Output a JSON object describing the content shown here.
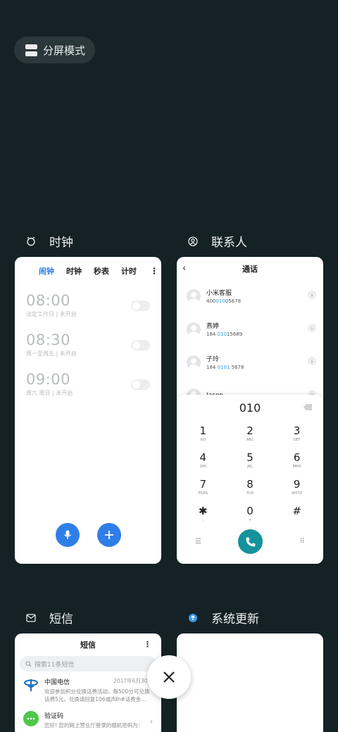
{
  "split_screen": {
    "label": "分屏模式"
  },
  "clock": {
    "title": "时钟",
    "tabs": [
      "闹钟",
      "时钟",
      "秒表",
      "计时"
    ],
    "alarms": [
      {
        "time": "08:00",
        "desc": "法定工作日 | 未开启"
      },
      {
        "time": "08:30",
        "desc": "周一至周五 | 未开启"
      },
      {
        "time": "09:00",
        "desc": "周六 周日 | 未开启"
      }
    ]
  },
  "contacts": {
    "title": "联系人",
    "header": "通话",
    "list": [
      {
        "name": "小米客服",
        "num_pre": "400",
        "num_hl": "010",
        "num_post": "05678"
      },
      {
        "name": "燕婷",
        "num_pre": "184 ",
        "num_hl": "010",
        "num_post": "15689"
      },
      {
        "name": "子玲",
        "num_pre": "184 ",
        "num_hl": "0101",
        "num_post": " 5678"
      },
      {
        "name": "Jason",
        "num_pre": "",
        "num_hl": "",
        "num_post": ""
      }
    ],
    "dial_input": "010",
    "keys": [
      {
        "d": "1",
        "l": "GD"
      },
      {
        "d": "2",
        "l": "ABC"
      },
      {
        "d": "3",
        "l": "DEF"
      },
      {
        "d": "4",
        "l": "GHI"
      },
      {
        "d": "5",
        "l": "JKL"
      },
      {
        "d": "6",
        "l": "MNO"
      },
      {
        "d": "7",
        "l": "PQRS"
      },
      {
        "d": "8",
        "l": "TUV"
      },
      {
        "d": "9",
        "l": "WXYZ"
      },
      {
        "d": "✱",
        "l": ","
      },
      {
        "d": "0",
        "l": "+"
      },
      {
        "d": "#",
        "l": ""
      }
    ]
  },
  "messages": {
    "title": "短信",
    "header": "短信",
    "search_placeholder": "搜索11条短信",
    "list": [
      {
        "sender": "中国电信",
        "date": "2017年6月30日",
        "line1": "欢迎参加积分兑换话费活动，每500分可兑换",
        "line2": "话费5元，兑换请回复106或jfdh#话费金..."
      },
      {
        "sender": "验证码",
        "date": "",
        "line1": "您好! 您的网上营业厅登录的随机密码为：",
        "line2": ""
      }
    ]
  },
  "system_update": {
    "title": "系统更新"
  },
  "colors": {
    "accent": "#2f7ee8",
    "call": "#14939b",
    "background": "#142226"
  }
}
